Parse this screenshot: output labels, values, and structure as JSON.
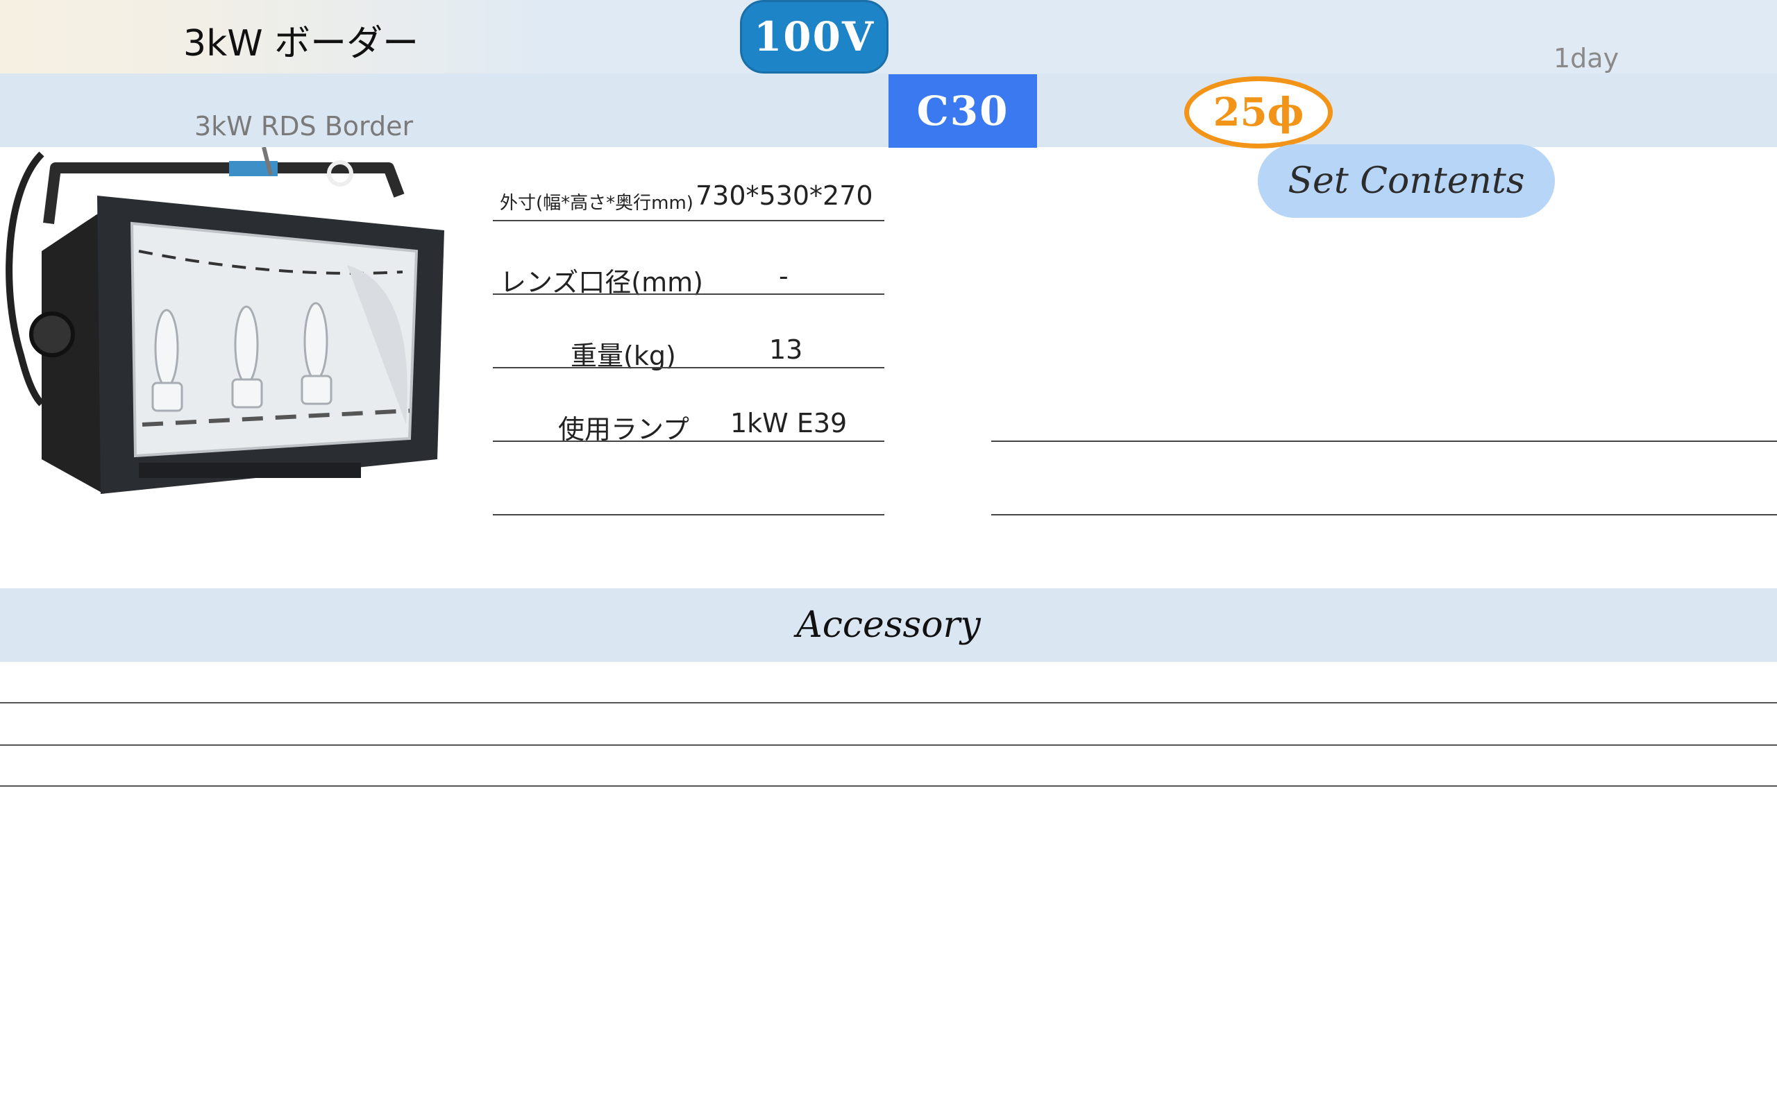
{
  "header": {
    "title": "3kW ボーダー",
    "subtitle": "3kW RDS Border",
    "rental_period": "1day",
    "voltage_badge": "100V",
    "plug_badge": "C30",
    "diameter_badge": "25ϕ",
    "set_contents_label": "Set Contents"
  },
  "specs": [
    {
      "label": "外寸(幅*高さ*奥行mm)",
      "value": "730*530*270"
    },
    {
      "label": "レンズ口径(mm)",
      "value": "-"
    },
    {
      "label": "重量(kg)",
      "value": "13"
    },
    {
      "label": "使用ランプ",
      "value": "1kW E39"
    },
    {
      "label": "",
      "value": ""
    }
  ],
  "accessory": {
    "title": "Accessory",
    "items": [
      "",
      "",
      ""
    ]
  }
}
